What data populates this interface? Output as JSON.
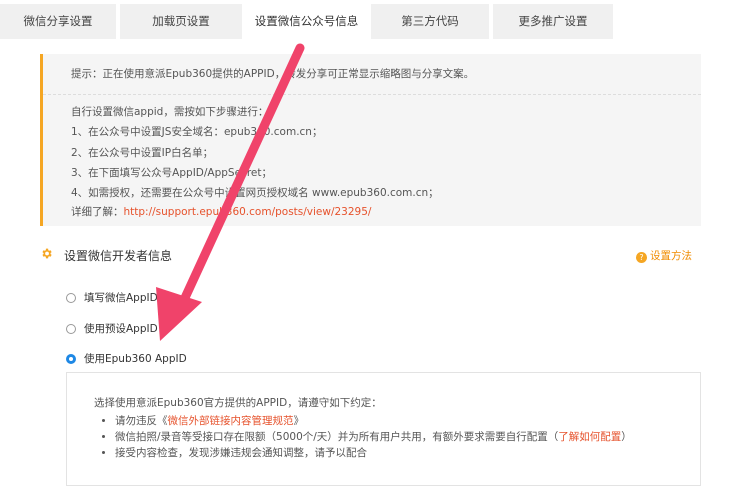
{
  "tabs": [
    {
      "label": "微信分享设置"
    },
    {
      "label": "加载页设置"
    },
    {
      "label": "设置微信公众号信息"
    },
    {
      "label": "第三方代码"
    },
    {
      "label": "更多推广设置"
    }
  ],
  "notice": {
    "tip": "提示：正在使用意派Epub360提供的APPID，转发分享可正常显示缩略图与分享文案。",
    "intro": "自行设置微信appid，需按如下步骤进行：",
    "steps": [
      "1、在公众号中设置JS安全域名：epub360.com.cn；",
      "2、在公众号中设置IP白名单；",
      "3、在下面填写公众号AppID/AppSecret；",
      "4、如需授权，还需要在公众号中设置网页授权域名 www.epub360.com.cn；"
    ],
    "detail_prefix": "详细了解：",
    "detail_link": "http://support.epub360.com/posts/view/23295/"
  },
  "section": {
    "icon": "gear-icon",
    "title": "设置微信开发者信息",
    "help_link": "设置方法",
    "help_icon": "question-icon"
  },
  "options": [
    {
      "label": "填写微信AppID",
      "checked": false
    },
    {
      "label": "使用预设AppID",
      "checked": false
    },
    {
      "label": "使用Epub360 AppID",
      "checked": true
    }
  ],
  "info": {
    "intro": "选择使用意派Epub360官方提供的APPID，请遵守如下约定：",
    "rule1_prefix": "请勿违反《",
    "rule1_link": "微信外部链接内容管理规范",
    "rule1_suffix": "》",
    "rule2_prefix": "微信拍照/录音等受接口存在限额（5000个/天）并为所有用户共用，有额外要求需要自行配置（",
    "rule2_link": "了解如何配置",
    "rule2_suffix": "）",
    "rule3": "接受内容检查，发现涉嫌违规会通知调整，请予以配合"
  },
  "colors": {
    "accent_orange": "#f5a623",
    "link_red": "#e6522c",
    "radio_blue": "#1e88e5",
    "arrow_pink": "#f0436a"
  }
}
